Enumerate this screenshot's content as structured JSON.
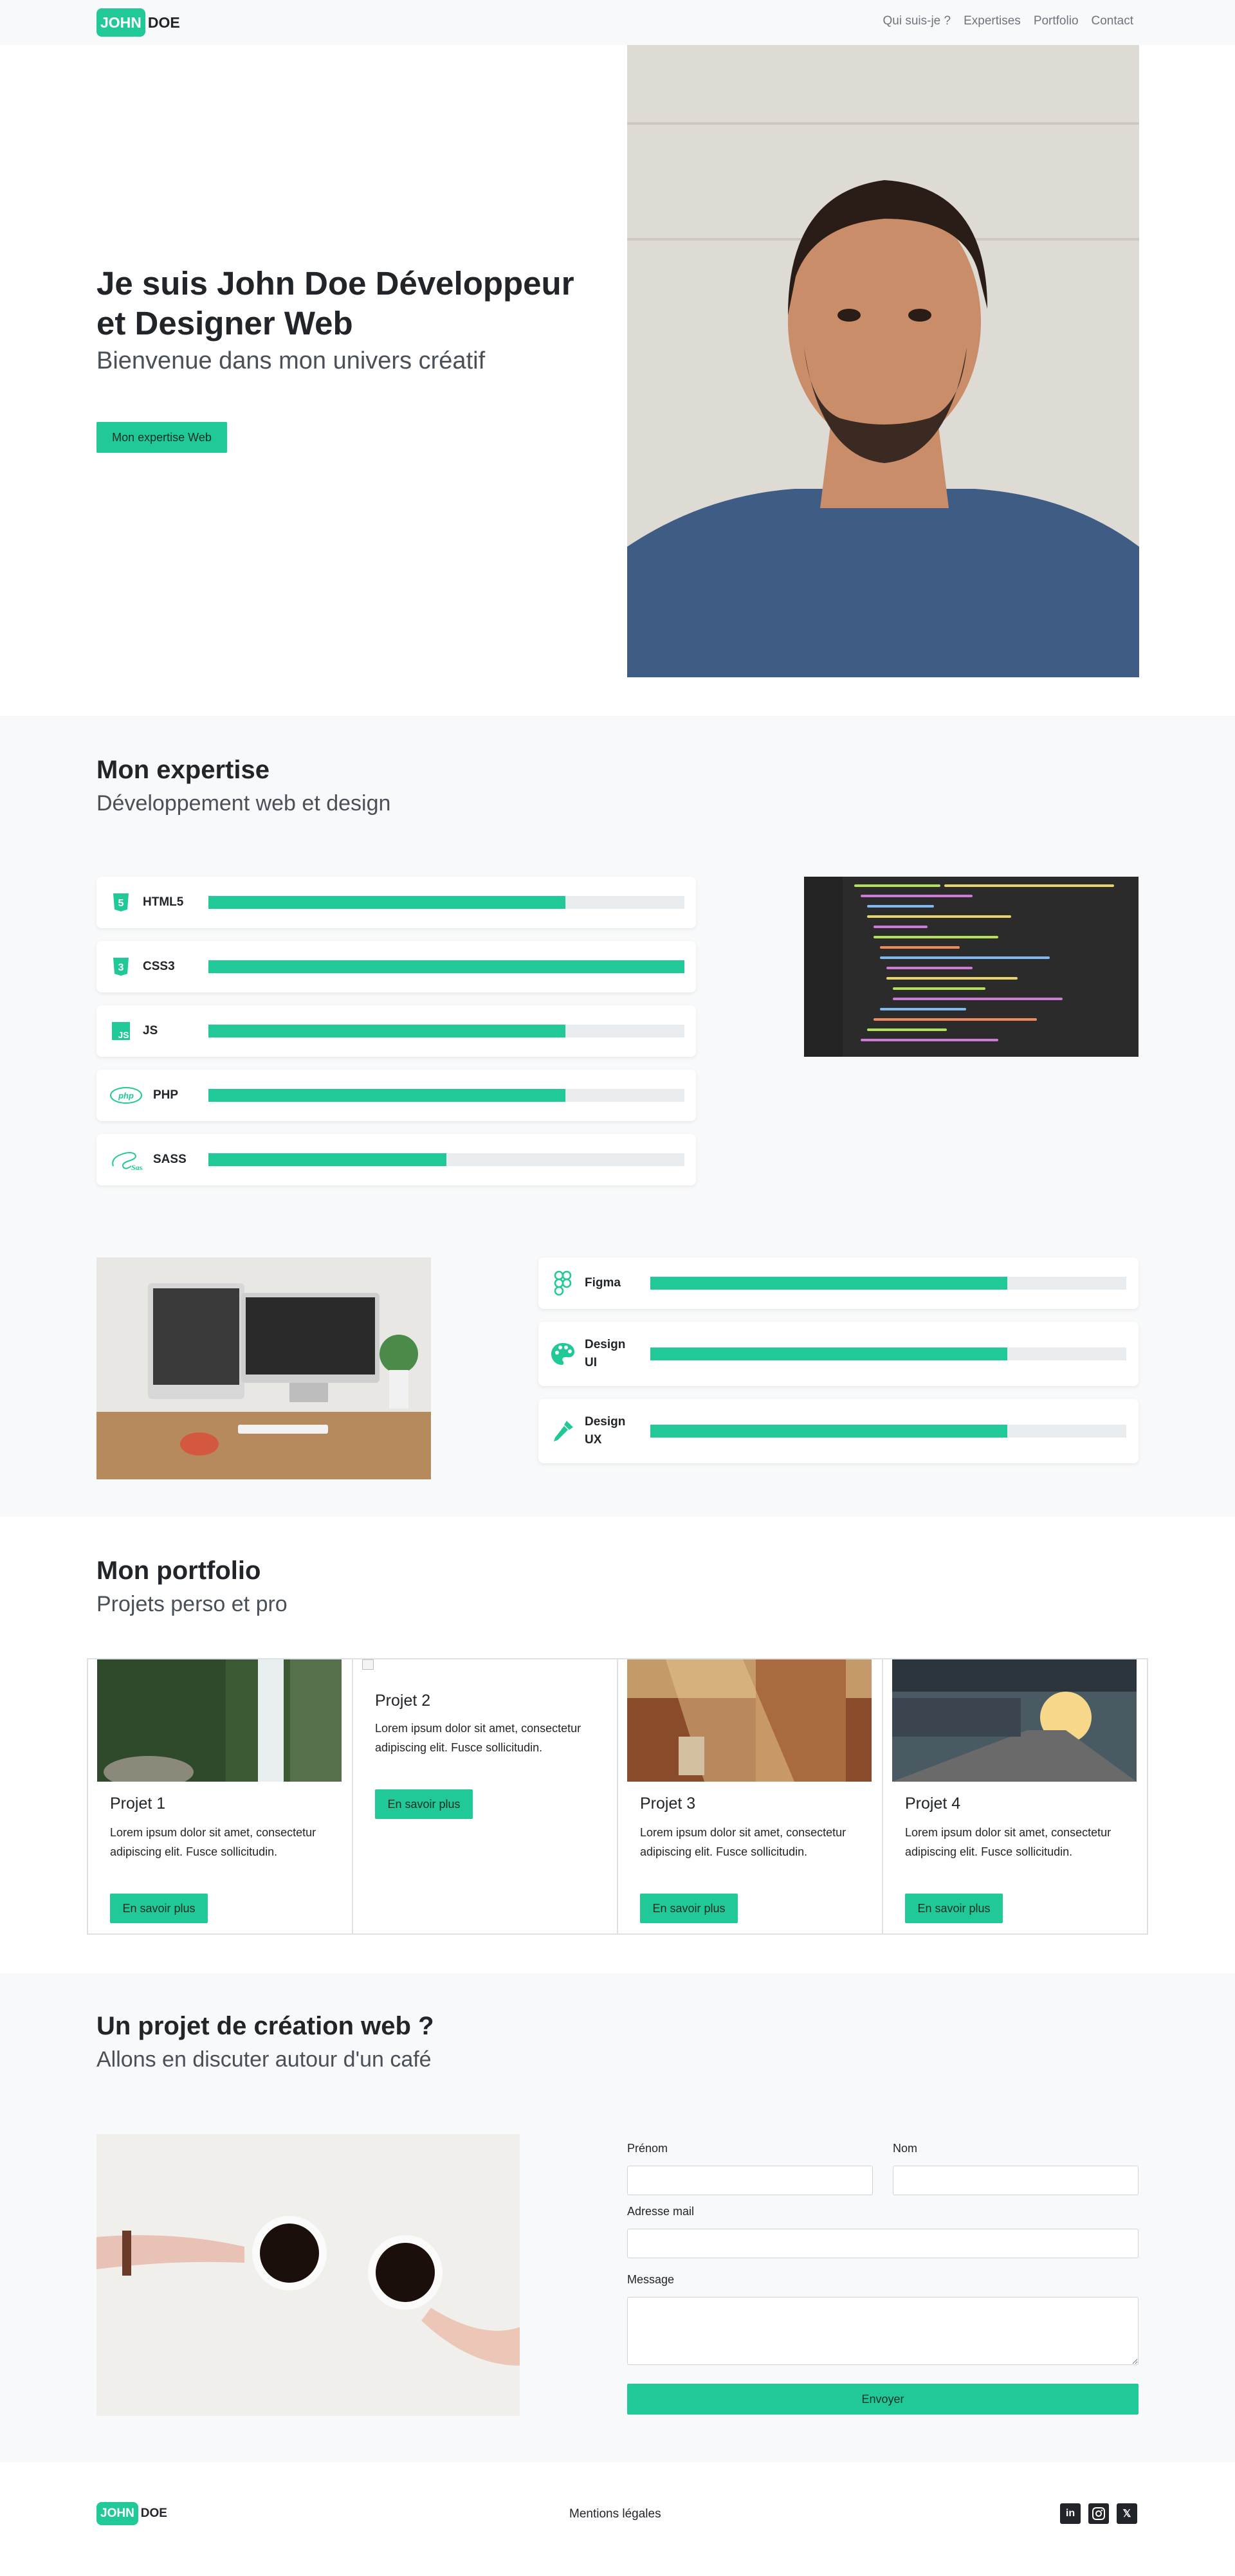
{
  "brand": {
    "first": "JOHN",
    "last": "DOE"
  },
  "nav": {
    "items": [
      "Qui suis-je ?",
      "Expertises",
      "Portfolio",
      "Contact"
    ]
  },
  "hero": {
    "title": "Je suis John Doe Développeur et Designer Web",
    "subtitle": "Bienvenue dans mon univers créatif",
    "button": "Mon expertise Web"
  },
  "expertise": {
    "title": "Mon expertise",
    "subtitle": "Développement web et design",
    "dev_skills": [
      {
        "name": "HTML5",
        "icon": "html5-icon",
        "level": 0.75
      },
      {
        "name": "CSS3",
        "icon": "css3-icon",
        "level": 1.0
      },
      {
        "name": "JS",
        "icon": "js-icon",
        "level": 0.75
      },
      {
        "name": "PHP",
        "icon": "php-icon",
        "level": 0.75
      },
      {
        "name": "SASS",
        "icon": "sass-icon",
        "level": 0.5
      }
    ],
    "design_skills": [
      {
        "name": "Figma",
        "icon": "figma-icon",
        "level": 0.75
      },
      {
        "name": "Design UI",
        "icon": "palette-icon",
        "level": 0.75
      },
      {
        "name": "Design UX",
        "icon": "pipette-icon",
        "level": 0.75
      }
    ]
  },
  "portfolio": {
    "title": "Mon portfolio",
    "subtitle": "Projets perso et pro",
    "projects": [
      {
        "title": "Projet 1",
        "desc": "Lorem ipsum dolor sit amet, consectetur adipiscing elit. Fusce sollicitudin.",
        "button": "En savoir plus"
      },
      {
        "title": "Projet 2",
        "desc": "Lorem ipsum dolor sit amet, consectetur adipiscing elit. Fusce sollicitudin.",
        "button": "En savoir plus"
      },
      {
        "title": "Projet 3",
        "desc": "Lorem ipsum dolor sit amet, consectetur adipiscing elit. Fusce sollicitudin.",
        "button": "En savoir plus"
      },
      {
        "title": "Projet 4",
        "desc": "Lorem ipsum dolor sit amet, consectetur adipiscing elit. Fusce sollicitudin.",
        "button": "En savoir plus"
      }
    ]
  },
  "contact": {
    "title": "Un projet de création web ?",
    "subtitle": "Allons en discuter autour d'un café",
    "labels": {
      "first_name": "Prénom",
      "last_name": "Nom",
      "email": "Adresse mail",
      "message": "Message"
    },
    "submit": "Envoyer"
  },
  "footer": {
    "legal": "Mentions légales",
    "socials": [
      "linkedin-icon",
      "instagram-icon",
      "x-icon"
    ]
  },
  "colors": {
    "accent": "#20c997",
    "light_bg": "#f8f9fa",
    "text": "#212529"
  }
}
